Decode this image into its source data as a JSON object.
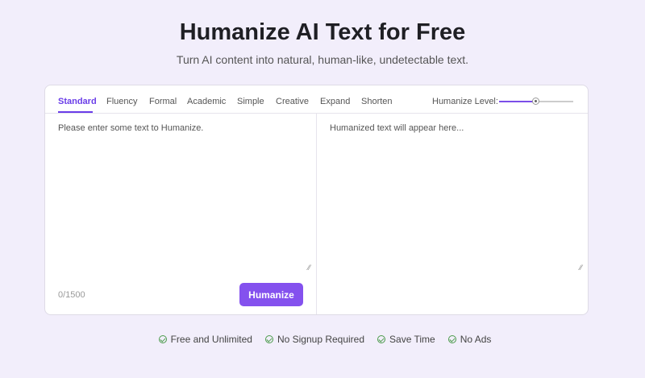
{
  "header": {
    "title": "Humanize AI Text for Free",
    "subtitle": "Turn AI content into natural, human-like, undetectable text."
  },
  "tabs": [
    {
      "label": "Standard",
      "active": true
    },
    {
      "label": "Fluency"
    },
    {
      "label": "Formal"
    },
    {
      "label": "Academic"
    },
    {
      "label": "Simple"
    },
    {
      "label": "Creative"
    },
    {
      "label": "Expand"
    },
    {
      "label": "Shorten"
    }
  ],
  "level": {
    "label": "Humanize Level:",
    "value_percent": 49
  },
  "input": {
    "placeholder": "Please enter some text to Humanize.",
    "count": "0/1500"
  },
  "output": {
    "placeholder": "Humanized text will appear here..."
  },
  "button": {
    "label": "Humanize"
  },
  "features": [
    "Free and Unlimited",
    "No Signup Required",
    "Save Time",
    "No Ads"
  ],
  "colors": {
    "accent": "#8451ee",
    "check": "#4a9a4a"
  }
}
